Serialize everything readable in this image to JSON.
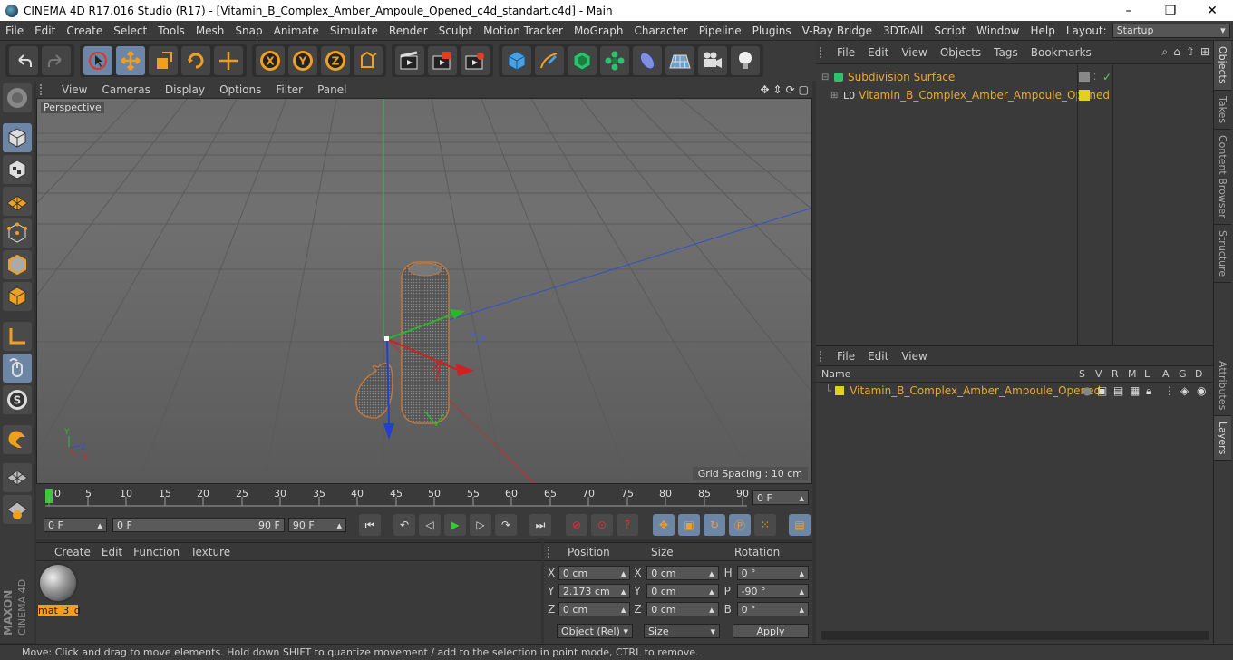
{
  "title": {
    "text": "CINEMA 4D R17.016 Studio (R17) - [Vitamin_B_Complex_Amber_Ampoule_Opened_c4d_standart.c4d] - Main",
    "min": "–",
    "max": "❐",
    "close": "✕"
  },
  "menubar": {
    "items": [
      "File",
      "Edit",
      "Create",
      "Select",
      "Tools",
      "Mesh",
      "Snap",
      "Animate",
      "Simulate",
      "Render",
      "Sculpt",
      "Motion Tracker",
      "MoGraph",
      "Character",
      "Pipeline",
      "Plugins",
      "V-Ray Bridge",
      "3DToAll",
      "Script",
      "Window",
      "Help"
    ],
    "layout_label": "Layout:",
    "layout_value": "Startup"
  },
  "viewport": {
    "menu": [
      "View",
      "Cameras",
      "Display",
      "Options",
      "Filter",
      "Panel"
    ],
    "camera": "Perspective",
    "grid_spacing": "Grid Spacing : 10 cm"
  },
  "timeline": {
    "ticks": [
      "0",
      "5",
      "10",
      "15",
      "20",
      "25",
      "30",
      "35",
      "40",
      "45",
      "50",
      "55",
      "60",
      "65",
      "70",
      "75",
      "80",
      "85",
      "90"
    ],
    "end_field": "0 F"
  },
  "transport": {
    "current": "0 F",
    "range_start": "0 F",
    "range_end": "90 F",
    "max": "90 F"
  },
  "materials": {
    "menu": [
      "Create",
      "Edit",
      "Function",
      "Texture"
    ],
    "items": [
      {
        "name": "mat_3_d"
      }
    ]
  },
  "coords": {
    "headers": [
      "Position",
      "Size",
      "Rotation"
    ],
    "rows": [
      {
        "a": "X",
        "pos": "0 cm",
        "b": "X",
        "size": "0 cm",
        "c": "H",
        "rot": "0 °"
      },
      {
        "a": "Y",
        "pos": "2.173 cm",
        "b": "Y",
        "size": "0 cm",
        "c": "P",
        "rot": "-90 °"
      },
      {
        "a": "Z",
        "pos": "0 cm",
        "b": "Z",
        "size": "0 cm",
        "c": "B",
        "rot": "0 °"
      }
    ],
    "mode": "Object (Rel)",
    "size_mode": "Size",
    "apply": "Apply"
  },
  "objects": {
    "menu": [
      "File",
      "Edit",
      "View",
      "Objects",
      "Tags",
      "Bookmarks"
    ],
    "items": [
      {
        "name": "Subdivision Surface"
      },
      {
        "name": "Vitamin_B_Complex_Amber_Ampoule_Opened"
      }
    ]
  },
  "layers": {
    "menu": [
      "File",
      "Edit",
      "View"
    ],
    "columns": [
      "Name",
      "S",
      "V",
      "R",
      "M",
      "L",
      "A",
      "G",
      "D"
    ],
    "items": [
      {
        "name": "Vitamin_B_Complex_Amber_Ampoule_Opened"
      }
    ]
  },
  "vtabs": [
    "Objects",
    "Takes",
    "Content Browser",
    "Structure",
    "Attributes",
    "Layers"
  ],
  "status": "Move: Click and drag to move elements. Hold down SHIFT to quantize movement / add to the selection in point mode, CTRL to remove.",
  "brand": {
    "logo1": "MAXON",
    "logo2": "CINEMA 4D"
  }
}
